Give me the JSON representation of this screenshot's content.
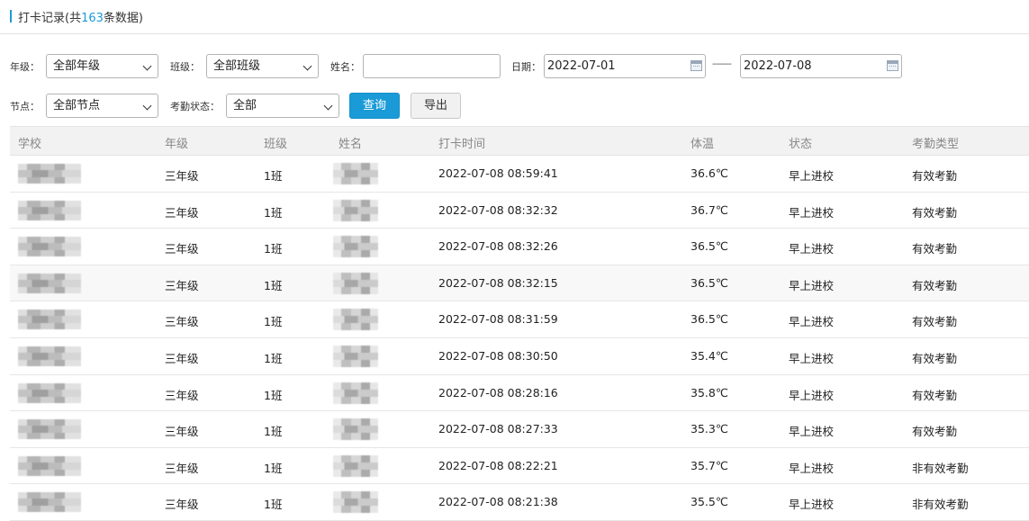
{
  "header": {
    "title_prefix": "打卡记录(共",
    "count": "163",
    "title_suffix": "条数据)"
  },
  "filters": {
    "grade": {
      "label": "年级：",
      "value": "全部年级"
    },
    "class": {
      "label": "班级：",
      "value": "全部班级"
    },
    "name": {
      "label": "姓名：",
      "value": ""
    },
    "date": {
      "label": "日期：",
      "start": "2022-07-01",
      "separator": "--------",
      "end": "2022-07-08"
    },
    "node": {
      "label": "节点：",
      "value": "全部节点"
    },
    "attendance_status": {
      "label": "考勤状态：",
      "value": "全部"
    },
    "query_label": "查询",
    "export_label": "导出"
  },
  "table": {
    "columns": [
      "学校",
      "年级",
      "班级",
      "姓名",
      "打卡时间",
      "体温",
      "状态",
      "考勤类型"
    ],
    "rows": [
      {
        "grade": "三年级",
        "class": "1班",
        "time": "2022-07-08 08:59:41",
        "temp": "36.6℃",
        "status": "早上进校",
        "type": "有效考勤"
      },
      {
        "grade": "三年级",
        "class": "1班",
        "time": "2022-07-08 08:32:32",
        "temp": "36.7℃",
        "status": "早上进校",
        "type": "有效考勤"
      },
      {
        "grade": "三年级",
        "class": "1班",
        "time": "2022-07-08 08:32:26",
        "temp": "36.5℃",
        "status": "早上进校",
        "type": "有效考勤"
      },
      {
        "grade": "三年级",
        "class": "1班",
        "time": "2022-07-08 08:32:15",
        "temp": "36.5℃",
        "status": "早上进校",
        "type": "有效考勤"
      },
      {
        "grade": "三年级",
        "class": "1班",
        "time": "2022-07-08 08:31:59",
        "temp": "36.5℃",
        "status": "早上进校",
        "type": "有效考勤"
      },
      {
        "grade": "三年级",
        "class": "1班",
        "time": "2022-07-08 08:30:50",
        "temp": "35.4℃",
        "status": "早上进校",
        "type": "有效考勤"
      },
      {
        "grade": "三年级",
        "class": "1班",
        "time": "2022-07-08 08:28:16",
        "temp": "35.8℃",
        "status": "早上进校",
        "type": "有效考勤"
      },
      {
        "grade": "三年级",
        "class": "1班",
        "time": "2022-07-08 08:27:33",
        "temp": "35.3℃",
        "status": "早上进校",
        "type": "有效考勤"
      },
      {
        "grade": "三年级",
        "class": "1班",
        "time": "2022-07-08 08:22:21",
        "temp": "35.7℃",
        "status": "早上进校",
        "type": "非有效考勤"
      },
      {
        "grade": "三年级",
        "class": "1班",
        "time": "2022-07-08 08:21:38",
        "temp": "35.5℃",
        "status": "早上进校",
        "type": "非有效考勤"
      }
    ]
  },
  "colors": {
    "accent": "#1a9bd7"
  }
}
